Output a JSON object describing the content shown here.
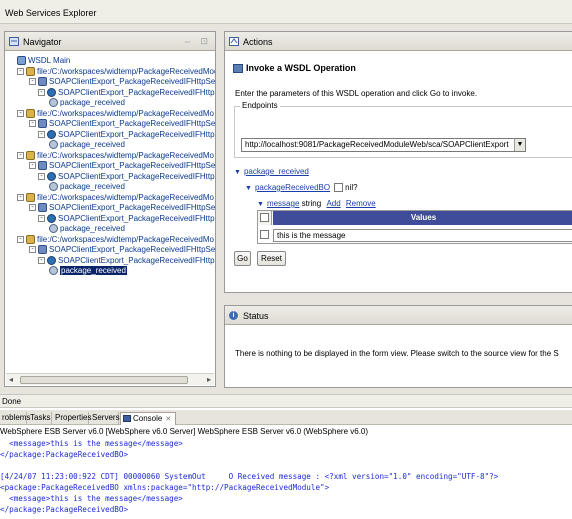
{
  "window": {
    "title": "Web Services Explorer"
  },
  "navigator": {
    "title": "Navigator",
    "tools": "⇔ ⊡",
    "rows": [
      {
        "text": "WSDL Main",
        "kind": "wsdl",
        "twist": ""
      },
      {
        "text": "file:/C:/workspaces/widtemp/PackageReceivedModu",
        "kind": "folder",
        "twist": "-"
      },
      {
        "text": "SOAPClientExport_PackageReceivedIFHttpServ",
        "kind": "svc",
        "twist": "-"
      },
      {
        "text": "SOAPClientExport_PackageReceivedIFHttpBi",
        "kind": "port",
        "twist": "-"
      },
      {
        "text": "package_received",
        "kind": "op",
        "twist": ""
      },
      {
        "text": "file:/C:/workspaces/widtemp/PackageReceivedMo",
        "kind": "folder",
        "twist": "-"
      },
      {
        "text": "SOAPClientExport_PackageReceivedIFHttpServ",
        "kind": "svc",
        "twist": "-"
      },
      {
        "text": "SOAPClientExport_PackageReceivedIFHttpBi",
        "kind": "port",
        "twist": "-"
      },
      {
        "text": "package_received",
        "kind": "op",
        "twist": ""
      },
      {
        "text": "file:/C:/workspaces/widtemp/PackageReceivedMo",
        "kind": "folder",
        "twist": "-"
      },
      {
        "text": "SOAPClientExport_PackageReceivedIFHttpServ",
        "kind": "svc",
        "twist": "-"
      },
      {
        "text": "SOAPClientExport_PackageReceivedIFHttpBi",
        "kind": "port",
        "twist": "-"
      },
      {
        "text": "package_received",
        "kind": "op",
        "twist": ""
      },
      {
        "text": "file:/C:/workspaces/widtemp/PackageReceivedMo",
        "kind": "folder",
        "twist": "-"
      },
      {
        "text": "SOAPClientExport_PackageReceivedIFHttpServ",
        "kind": "svc",
        "twist": "-"
      },
      {
        "text": "SOAPClientExport_PackageReceivedIFHttpBi",
        "kind": "port",
        "twist": "-"
      },
      {
        "text": "package_received",
        "kind": "op",
        "twist": ""
      },
      {
        "text": "file:/C:/workspaces/widtemp/PackageReceivedMo",
        "kind": "folder",
        "twist": "-"
      },
      {
        "text": "SOAPClientExport_PackageReceivedIFHttpServ",
        "kind": "svc",
        "twist": "-"
      },
      {
        "text": "SOAPClientExport_PackageReceivedIFHttpBi",
        "kind": "port",
        "twist": "-"
      },
      {
        "text": "package_received",
        "kind": "op",
        "twist": "",
        "selected": true
      }
    ]
  },
  "actions": {
    "title": "Actions",
    "heading": "Invoke a WSDL Operation",
    "instruction": "Enter the parameters of this WSDL operation and click Go to invoke.",
    "endpoints_label": "Endpoints",
    "endpoint_value": "http://localhost:9081/PackageReceivedModuleWeb/sca/SOAPClientExport",
    "operation_link": "package_received",
    "bo_link": "packageReceivedBO",
    "nil_label": "nil?",
    "message_link": "message",
    "message_type": "string",
    "add_link": "Add",
    "remove_link": "Remove",
    "values_header": "Values",
    "value_text": "this is the message",
    "go_label": "Go",
    "reset_label": "Reset"
  },
  "status": {
    "title": "Status",
    "message": "There is nothing to be displayed in the form view. Please switch to the source view for the S"
  },
  "statusbar": {
    "text": "Done"
  },
  "tabs": [
    {
      "label": "Problems",
      "display": "roblems"
    },
    {
      "label": "Tasks",
      "display": "Tasks"
    },
    {
      "label": "Properties",
      "display": "Properties"
    },
    {
      "label": "Servers",
      "display": "Servers"
    },
    {
      "label": "Console",
      "display": "Console",
      "active": true
    }
  ],
  "console": {
    "header": "WebSphere ESB Server v6.0 [WebSphere v6.0 Server] WebSphere ESB Server v6.0 (WebSphere v6.0)",
    "lines": [
      "  <message>this is the message</message>",
      "</package:PackageReceivedBO>",
      "",
      "[4/24/07 11:23:00:922 CDT] 00000060 SystemOut     O Received message : <?xml version=\"1.0\" encoding=\"UTF-8\"?>",
      "<package:PackageReceivedBO xmlns:package=\"http://PackageReceivedModule\">",
      "  <message>this is the message</message>",
      "</package:PackageReceivedBO>"
    ]
  },
  "colors": {
    "link": "#1a3fa8",
    "values_header_bg": "#3e4c9a",
    "selection_bg": "#0a246a",
    "console_text": "#1d2bd6"
  }
}
